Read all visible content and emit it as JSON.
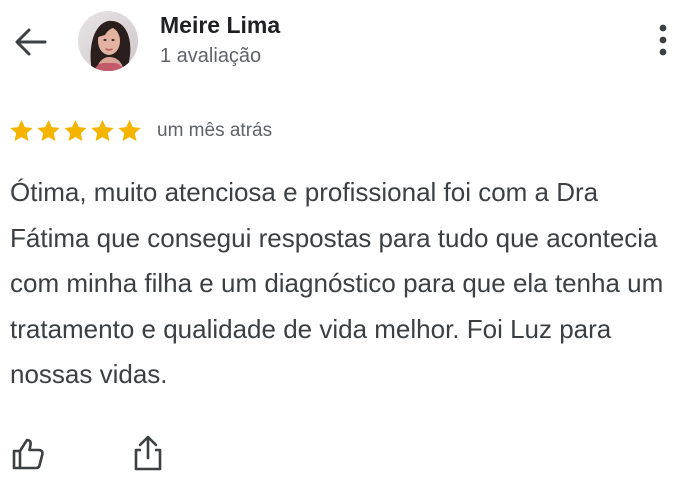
{
  "header": {
    "back_icon": "arrow-left-icon",
    "reviewer_name": "Meire Lima",
    "review_count": "1 avaliação",
    "more_icon": "more-vertical-icon"
  },
  "review": {
    "rating": 5,
    "rating_max": 5,
    "star_color": "#F4B400",
    "date": "um mês atrás",
    "text": "Ótima, muito atenciosa e profissional foi com a Dra Fátima que consegui respostas para tudo que acontecia com minha filha e um diagnóstico para que ela tenha um tratamento e qualidade de vida melhor. Foi Luz para nossas vidas."
  },
  "actions": {
    "like_icon": "thumbs-up-icon",
    "share_icon": "share-icon"
  }
}
